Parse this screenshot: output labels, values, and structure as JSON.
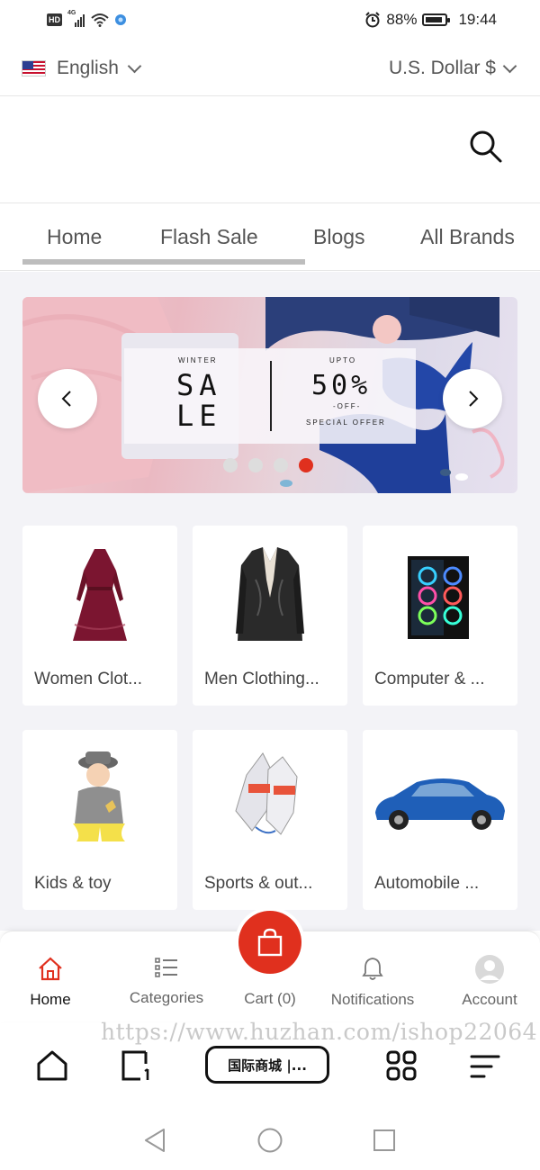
{
  "status_bar": {
    "network_badge": "HD",
    "signal_type": "4G",
    "battery_level": "88%",
    "battery_fraction": 0.88,
    "time": "19:44"
  },
  "header": {
    "language": "English",
    "currency": "U.S. Dollar $"
  },
  "tabs": [
    {
      "label": "Home",
      "active": true
    },
    {
      "label": "Flash Sale",
      "active": false
    },
    {
      "label": "Blogs",
      "active": false
    },
    {
      "label": "All Brands",
      "active": false
    }
  ],
  "banner": {
    "winter": "WINTER",
    "sale_line1": "SA",
    "sale_line2": "LE",
    "upto": "UPTO",
    "percent": "50%",
    "off": "-OFF-",
    "special": "SPECIAL OFFER",
    "slide_count": 4,
    "active_slide": 4
  },
  "categories": [
    {
      "label": "Women Clot...",
      "icon": "dress-image"
    },
    {
      "label": "Men Clothing...",
      "icon": "blazer-image"
    },
    {
      "label": "Computer & ...",
      "icon": "pc-case-image"
    },
    {
      "label": "Kids & toy",
      "icon": "baby-image"
    },
    {
      "label": "Sports & out...",
      "icon": "gloves-image"
    },
    {
      "label": "Automobile ...",
      "icon": "car-image"
    }
  ],
  "bottom_nav": {
    "home": "Home",
    "categories": "Categories",
    "cart": "Cart (0)",
    "notifications": "Notifications",
    "account": "Account"
  },
  "watermark": "https://www.huzhan.com/ishop22064",
  "browser": {
    "url_label": "国际商城 |..."
  },
  "colors": {
    "accent": "#e0301e",
    "page_bg": "#f3f3f7",
    "active_nav": "#e0301e"
  }
}
